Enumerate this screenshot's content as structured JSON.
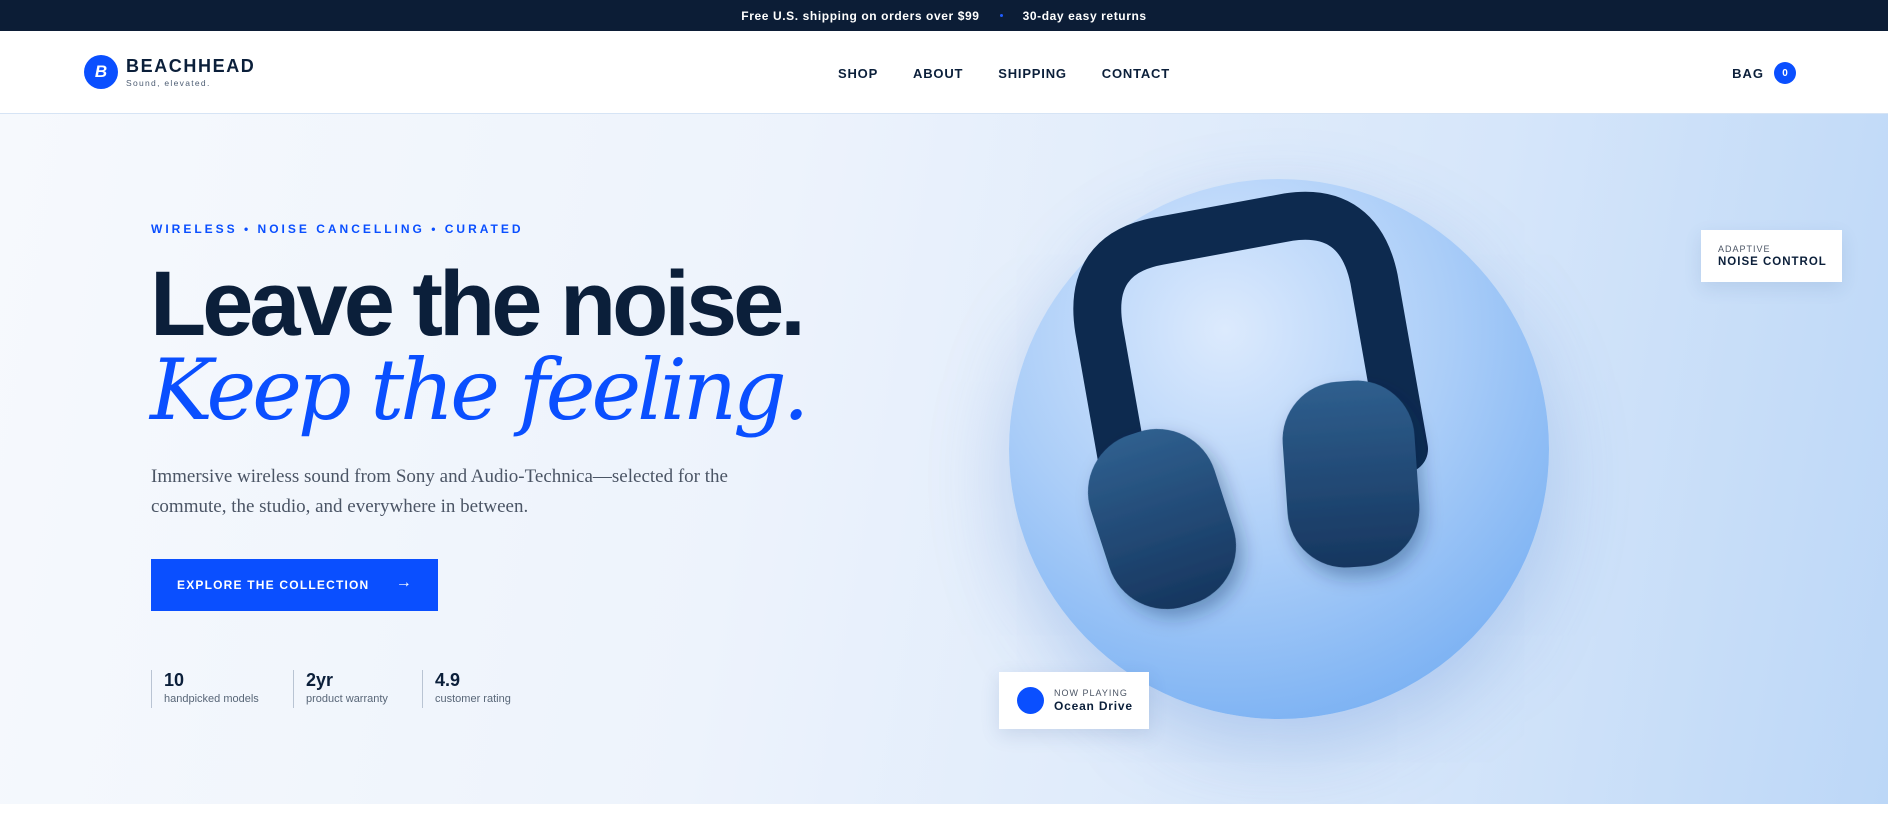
{
  "announcement": {
    "shipping": "Free U.S. shipping on orders over $99",
    "returns": "30-day easy returns"
  },
  "brand": {
    "mark": "B",
    "name": "BEACHHEAD",
    "tagline": "Sound, elevated."
  },
  "nav": {
    "items": [
      {
        "label": "SHOP"
      },
      {
        "label": "ABOUT"
      },
      {
        "label": "SHIPPING"
      },
      {
        "label": "CONTACT"
      }
    ]
  },
  "bag": {
    "label": "BAG",
    "count": "0"
  },
  "hero": {
    "eyebrow": "WIRELESS • NOISE CANCELLING • CURATED",
    "headline": "Leave the noise.",
    "headline_accent": "Keep the feeling.",
    "subtext": "Immersive wireless sound from Sony and Audio-Technica—selected for the commute, the studio, and everywhere in between.",
    "cta_label": "EXPLORE THE COLLECTION",
    "cta_arrow": "→",
    "stats": [
      {
        "value": "10",
        "label": "handpicked models"
      },
      {
        "value": "2yr",
        "label": "product warranty"
      },
      {
        "value": "4.9",
        "label": "customer rating"
      }
    ]
  },
  "badges": {
    "feature_small": "ADAPTIVE",
    "feature_big": "NOISE CONTROL",
    "now_playing_small": "NOW PLAYING",
    "now_playing_track": "Ocean Drive"
  },
  "icons": {
    "logo": "b-logo-icon",
    "arrow": "arrow-right-icon",
    "product": "headphones-illustration",
    "play": "now-playing-dot-icon"
  },
  "colors": {
    "accent": "#0a4fff",
    "navy": "#0b1f3a",
    "announce_bg": "#0c1d36"
  }
}
